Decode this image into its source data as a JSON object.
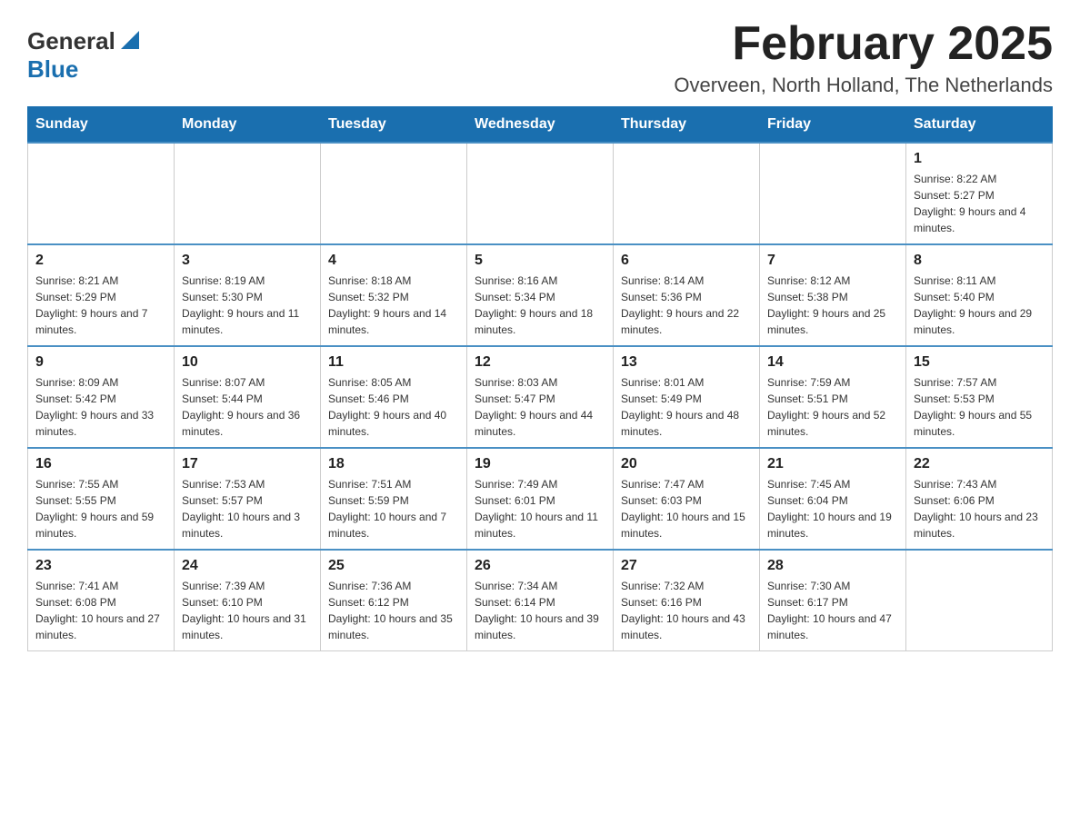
{
  "header": {
    "logo_general": "General",
    "logo_blue": "Blue",
    "title": "February 2025",
    "subtitle": "Overveen, North Holland, The Netherlands"
  },
  "calendar": {
    "days_of_week": [
      "Sunday",
      "Monday",
      "Tuesday",
      "Wednesday",
      "Thursday",
      "Friday",
      "Saturday"
    ],
    "weeks": [
      [
        {
          "day": "",
          "sunrise": "",
          "sunset": "",
          "daylight": ""
        },
        {
          "day": "",
          "sunrise": "",
          "sunset": "",
          "daylight": ""
        },
        {
          "day": "",
          "sunrise": "",
          "sunset": "",
          "daylight": ""
        },
        {
          "day": "",
          "sunrise": "",
          "sunset": "",
          "daylight": ""
        },
        {
          "day": "",
          "sunrise": "",
          "sunset": "",
          "daylight": ""
        },
        {
          "day": "",
          "sunrise": "",
          "sunset": "",
          "daylight": ""
        },
        {
          "day": "1",
          "sunrise": "Sunrise: 8:22 AM",
          "sunset": "Sunset: 5:27 PM",
          "daylight": "Daylight: 9 hours and 4 minutes."
        }
      ],
      [
        {
          "day": "2",
          "sunrise": "Sunrise: 8:21 AM",
          "sunset": "Sunset: 5:29 PM",
          "daylight": "Daylight: 9 hours and 7 minutes."
        },
        {
          "day": "3",
          "sunrise": "Sunrise: 8:19 AM",
          "sunset": "Sunset: 5:30 PM",
          "daylight": "Daylight: 9 hours and 11 minutes."
        },
        {
          "day": "4",
          "sunrise": "Sunrise: 8:18 AM",
          "sunset": "Sunset: 5:32 PM",
          "daylight": "Daylight: 9 hours and 14 minutes."
        },
        {
          "day": "5",
          "sunrise": "Sunrise: 8:16 AM",
          "sunset": "Sunset: 5:34 PM",
          "daylight": "Daylight: 9 hours and 18 minutes."
        },
        {
          "day": "6",
          "sunrise": "Sunrise: 8:14 AM",
          "sunset": "Sunset: 5:36 PM",
          "daylight": "Daylight: 9 hours and 22 minutes."
        },
        {
          "day": "7",
          "sunrise": "Sunrise: 8:12 AM",
          "sunset": "Sunset: 5:38 PM",
          "daylight": "Daylight: 9 hours and 25 minutes."
        },
        {
          "day": "8",
          "sunrise": "Sunrise: 8:11 AM",
          "sunset": "Sunset: 5:40 PM",
          "daylight": "Daylight: 9 hours and 29 minutes."
        }
      ],
      [
        {
          "day": "9",
          "sunrise": "Sunrise: 8:09 AM",
          "sunset": "Sunset: 5:42 PM",
          "daylight": "Daylight: 9 hours and 33 minutes."
        },
        {
          "day": "10",
          "sunrise": "Sunrise: 8:07 AM",
          "sunset": "Sunset: 5:44 PM",
          "daylight": "Daylight: 9 hours and 36 minutes."
        },
        {
          "day": "11",
          "sunrise": "Sunrise: 8:05 AM",
          "sunset": "Sunset: 5:46 PM",
          "daylight": "Daylight: 9 hours and 40 minutes."
        },
        {
          "day": "12",
          "sunrise": "Sunrise: 8:03 AM",
          "sunset": "Sunset: 5:47 PM",
          "daylight": "Daylight: 9 hours and 44 minutes."
        },
        {
          "day": "13",
          "sunrise": "Sunrise: 8:01 AM",
          "sunset": "Sunset: 5:49 PM",
          "daylight": "Daylight: 9 hours and 48 minutes."
        },
        {
          "day": "14",
          "sunrise": "Sunrise: 7:59 AM",
          "sunset": "Sunset: 5:51 PM",
          "daylight": "Daylight: 9 hours and 52 minutes."
        },
        {
          "day": "15",
          "sunrise": "Sunrise: 7:57 AM",
          "sunset": "Sunset: 5:53 PM",
          "daylight": "Daylight: 9 hours and 55 minutes."
        }
      ],
      [
        {
          "day": "16",
          "sunrise": "Sunrise: 7:55 AM",
          "sunset": "Sunset: 5:55 PM",
          "daylight": "Daylight: 9 hours and 59 minutes."
        },
        {
          "day": "17",
          "sunrise": "Sunrise: 7:53 AM",
          "sunset": "Sunset: 5:57 PM",
          "daylight": "Daylight: 10 hours and 3 minutes."
        },
        {
          "day": "18",
          "sunrise": "Sunrise: 7:51 AM",
          "sunset": "Sunset: 5:59 PM",
          "daylight": "Daylight: 10 hours and 7 minutes."
        },
        {
          "day": "19",
          "sunrise": "Sunrise: 7:49 AM",
          "sunset": "Sunset: 6:01 PM",
          "daylight": "Daylight: 10 hours and 11 minutes."
        },
        {
          "day": "20",
          "sunrise": "Sunrise: 7:47 AM",
          "sunset": "Sunset: 6:03 PM",
          "daylight": "Daylight: 10 hours and 15 minutes."
        },
        {
          "day": "21",
          "sunrise": "Sunrise: 7:45 AM",
          "sunset": "Sunset: 6:04 PM",
          "daylight": "Daylight: 10 hours and 19 minutes."
        },
        {
          "day": "22",
          "sunrise": "Sunrise: 7:43 AM",
          "sunset": "Sunset: 6:06 PM",
          "daylight": "Daylight: 10 hours and 23 minutes."
        }
      ],
      [
        {
          "day": "23",
          "sunrise": "Sunrise: 7:41 AM",
          "sunset": "Sunset: 6:08 PM",
          "daylight": "Daylight: 10 hours and 27 minutes."
        },
        {
          "day": "24",
          "sunrise": "Sunrise: 7:39 AM",
          "sunset": "Sunset: 6:10 PM",
          "daylight": "Daylight: 10 hours and 31 minutes."
        },
        {
          "day": "25",
          "sunrise": "Sunrise: 7:36 AM",
          "sunset": "Sunset: 6:12 PM",
          "daylight": "Daylight: 10 hours and 35 minutes."
        },
        {
          "day": "26",
          "sunrise": "Sunrise: 7:34 AM",
          "sunset": "Sunset: 6:14 PM",
          "daylight": "Daylight: 10 hours and 39 minutes."
        },
        {
          "day": "27",
          "sunrise": "Sunrise: 7:32 AM",
          "sunset": "Sunset: 6:16 PM",
          "daylight": "Daylight: 10 hours and 43 minutes."
        },
        {
          "day": "28",
          "sunrise": "Sunrise: 7:30 AM",
          "sunset": "Sunset: 6:17 PM",
          "daylight": "Daylight: 10 hours and 47 minutes."
        },
        {
          "day": "",
          "sunrise": "",
          "sunset": "",
          "daylight": ""
        }
      ]
    ]
  }
}
